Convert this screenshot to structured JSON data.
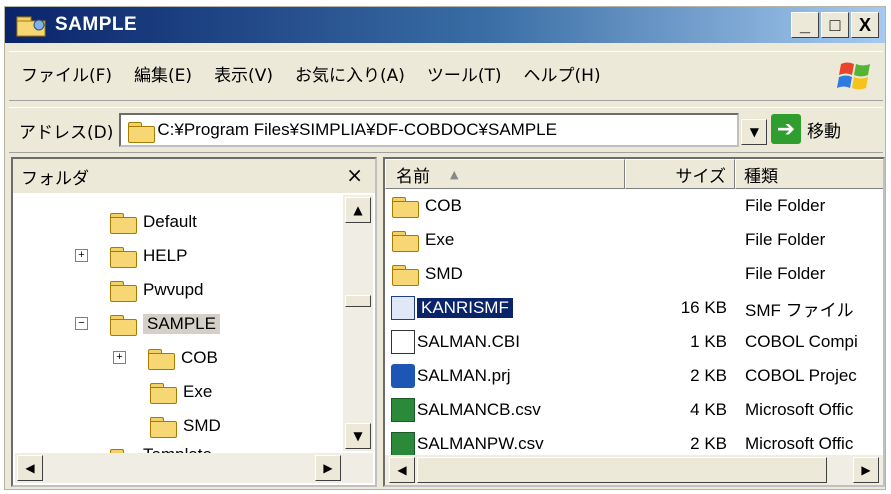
{
  "window": {
    "title": "SAMPLE",
    "caption_buttons": {
      "minimize": "_",
      "maximize": "□",
      "close": "X"
    }
  },
  "menubar": {
    "items": [
      {
        "label": "ファイル(F)"
      },
      {
        "label": "編集(E)"
      },
      {
        "label": "表示(V)"
      },
      {
        "label": "お気に入り(A)"
      },
      {
        "label": "ツール(T)"
      },
      {
        "label": "ヘルプ(H)"
      }
    ]
  },
  "addressbar": {
    "label": "アドレス(D)",
    "value": "C:¥Program Files¥SIMPLIA¥DF-COBDOC¥SAMPLE",
    "go_label": "移動"
  },
  "folder_pane": {
    "header": "フォルダ",
    "close_glyph": "×",
    "tree": [
      {
        "label": "Default",
        "expander": ""
      },
      {
        "label": "HELP",
        "expander": "+"
      },
      {
        "label": "Pwvupd",
        "expander": ""
      },
      {
        "label": "SAMPLE",
        "expander": "−",
        "selected": true
      },
      {
        "label": "COB",
        "expander": "+"
      },
      {
        "label": "Exe",
        "expander": ""
      },
      {
        "label": "SMD",
        "expander": ""
      },
      {
        "label": "Template",
        "expander": ""
      }
    ]
  },
  "list_pane": {
    "columns": {
      "name": "名前",
      "size": "サイズ",
      "type": "種類"
    },
    "rows": [
      {
        "name": "COB",
        "size": "",
        "type": "File Folder",
        "icon": "folder-icon"
      },
      {
        "name": "Exe",
        "size": "",
        "type": "File Folder",
        "icon": "folder-icon"
      },
      {
        "name": "SMD",
        "size": "",
        "type": "File Folder",
        "icon": "folder-icon"
      },
      {
        "name": "KANRISMF",
        "size": "16 KB",
        "type": "SMF ファイル",
        "icon": "smf-file-icon",
        "selected": true
      },
      {
        "name": "SALMAN.CBI",
        "size": "1 KB",
        "type": "COBOL Compi",
        "icon": "cbi-file-icon"
      },
      {
        "name": "SALMAN.prj",
        "size": "2 KB",
        "type": "COBOL Projec",
        "icon": "project-file-icon"
      },
      {
        "name": "SALMANCB.csv",
        "size": "4 KB",
        "type": "Microsoft Offic",
        "icon": "csv-file-icon"
      },
      {
        "name": "SALMANPW.csv",
        "size": "2 KB",
        "type": "Microsoft Offic",
        "icon": "csv-file-icon"
      }
    ]
  },
  "colors": {
    "title_gradient_start": "#0a246a",
    "selection": "#0a246a",
    "chrome": "#ece9d8"
  }
}
